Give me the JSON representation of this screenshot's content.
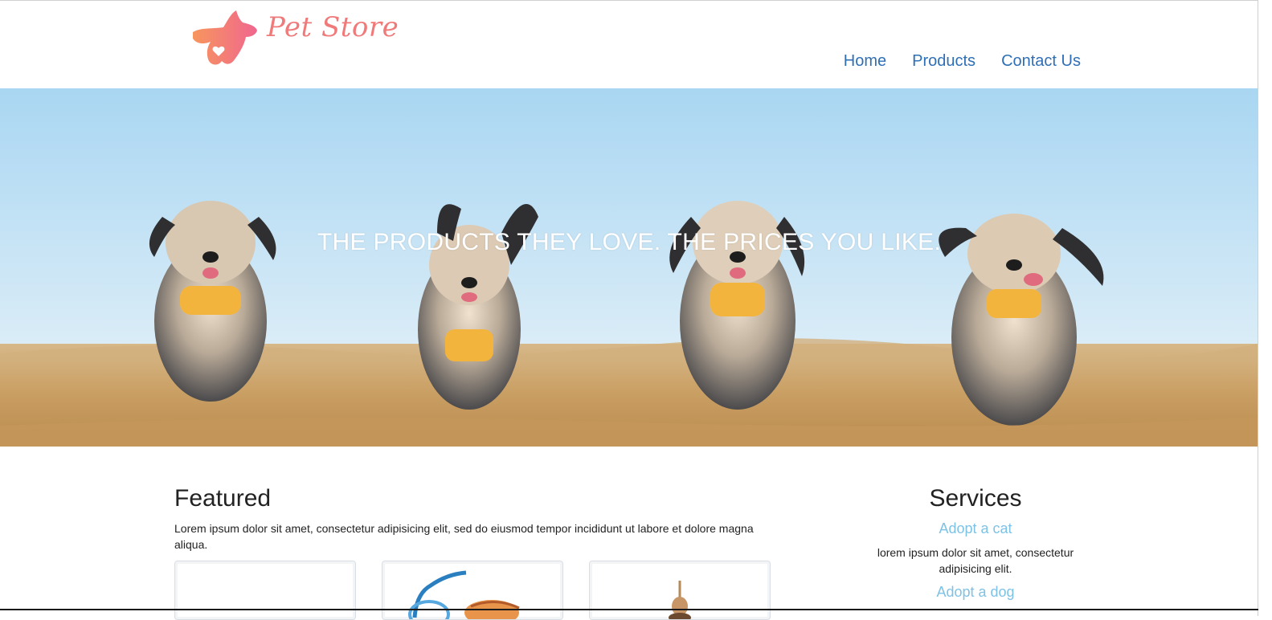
{
  "brand": {
    "name": "Pet Store",
    "logo_icon": "dog-heart-icon",
    "color": "#f07a7a"
  },
  "nav": {
    "items": [
      "Home",
      "Products",
      "Contact Us"
    ],
    "color": "#2f6fb5"
  },
  "hero": {
    "title": "THE PRODUCTS THEY LOVE. THE PRICES YOU LIKE."
  },
  "featured": {
    "title": "Featured",
    "text": "Lorem ipsum dolor sit amet, consectetur adipisicing elit, sed do eiusmod tempor incididunt ut labore et dolore magna aliqua."
  },
  "services": {
    "title": "Services",
    "link_color": "#7ec2e6",
    "items": [
      {
        "label": "Adopt a cat",
        "text": "lorem ipsum dolor sit amet, consectetur adipisicing elit."
      },
      {
        "label": "Adopt a dog"
      }
    ]
  }
}
